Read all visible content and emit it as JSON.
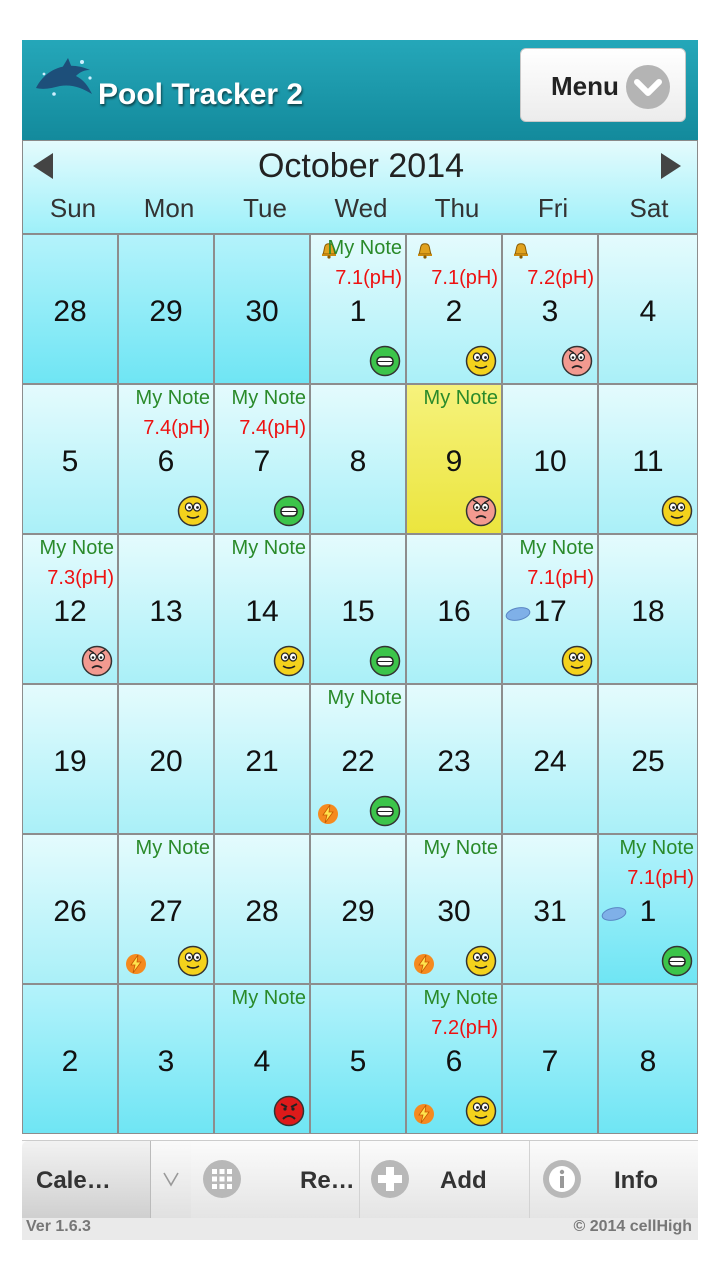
{
  "header": {
    "title": "Pool Tracker 2",
    "menu_label": "Menu"
  },
  "calendar": {
    "month_title": "October 2014",
    "weekdays": [
      "Sun",
      "Mon",
      "Tue",
      "Wed",
      "Thu",
      "Fri",
      "Sat"
    ],
    "weeks": [
      [
        {
          "day": "28",
          "other": true
        },
        {
          "day": "29",
          "other": true
        },
        {
          "day": "30",
          "other": true
        },
        {
          "day": "1",
          "note": "My Note",
          "ph": "7.1(pH)",
          "bell": true,
          "smiley": "happy"
        },
        {
          "day": "2",
          "ph": "7.1(pH)",
          "bell": true,
          "smiley": "neutral"
        },
        {
          "day": "3",
          "ph": "7.2(pH)",
          "bell": true,
          "smiley": "sad"
        },
        {
          "day": "4"
        }
      ],
      [
        {
          "day": "5"
        },
        {
          "day": "6",
          "note": "My Note",
          "ph": "7.4(pH)",
          "smiley": "neutral"
        },
        {
          "day": "7",
          "note": "My Note",
          "ph": "7.4(pH)",
          "smiley": "happy"
        },
        {
          "day": "8"
        },
        {
          "day": "9",
          "note": "My Note",
          "smiley": "sad",
          "today": true
        },
        {
          "day": "10"
        },
        {
          "day": "11",
          "smiley": "neutral"
        }
      ],
      [
        {
          "day": "12",
          "note": "My Note",
          "ph": "7.3(pH)",
          "smiley": "sad"
        },
        {
          "day": "13"
        },
        {
          "day": "14",
          "note": "My Note",
          "smiley": "neutral"
        },
        {
          "day": "15",
          "smiley": "happy"
        },
        {
          "day": "16"
        },
        {
          "day": "17",
          "note": "My Note",
          "ph": "7.1(pH)",
          "pill": true,
          "smiley": "neutral"
        },
        {
          "day": "18"
        }
      ],
      [
        {
          "day": "19"
        },
        {
          "day": "20"
        },
        {
          "day": "21"
        },
        {
          "day": "22",
          "note": "My Note",
          "bolt": true,
          "smiley": "happy"
        },
        {
          "day": "23"
        },
        {
          "day": "24"
        },
        {
          "day": "25"
        }
      ],
      [
        {
          "day": "26"
        },
        {
          "day": "27",
          "note": "My Note",
          "bolt": true,
          "smiley": "neutral"
        },
        {
          "day": "28"
        },
        {
          "day": "29"
        },
        {
          "day": "30",
          "note": "My Note",
          "bolt": true,
          "smiley": "neutral"
        },
        {
          "day": "31"
        },
        {
          "day": "1",
          "other": true,
          "note": "My Note",
          "ph": "7.1(pH)",
          "pill": true,
          "smiley": "happy"
        }
      ],
      [
        {
          "day": "2",
          "other": true
        },
        {
          "day": "3",
          "other": true
        },
        {
          "day": "4",
          "other": true,
          "note": "My Note",
          "smiley": "angry"
        },
        {
          "day": "5",
          "other": true
        },
        {
          "day": "6",
          "other": true,
          "note": "My Note",
          "ph": "7.2(pH)",
          "bolt": true,
          "smiley": "neutral"
        },
        {
          "day": "7",
          "other": true
        },
        {
          "day": "8",
          "other": true
        }
      ]
    ]
  },
  "toolbar": {
    "calendar_label": "Cale…",
    "reports_label": "Re…",
    "add_label": "Add",
    "info_label": "Info"
  },
  "footer": {
    "version": "Ver 1.6.3",
    "copyright": "© 2014 cellHigh"
  },
  "colors": {
    "header": "#1597a8",
    "note": "#2a8a2a",
    "ph": "#ee1111",
    "today": "#f4f06a",
    "cell_current": "#bff4fb",
    "cell_other": "#8eeaf6"
  }
}
